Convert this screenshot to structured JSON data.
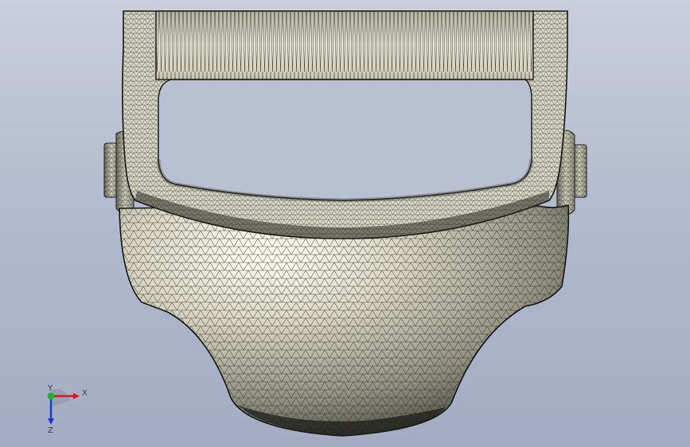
{
  "viewport": {
    "background_top": "#c9cfdd",
    "background_bottom": "#a3acc2"
  },
  "model": {
    "render_style": "shaded-with-mesh-edges",
    "surface_color": "#d8d6c4",
    "mesh_color": "#2a2a24"
  },
  "triad": {
    "x_label": "X",
    "y_label": "Y",
    "z_label": "Z",
    "x_color": "#e0141b",
    "y_color": "#19b52a",
    "z_color": "#1a37d8"
  }
}
